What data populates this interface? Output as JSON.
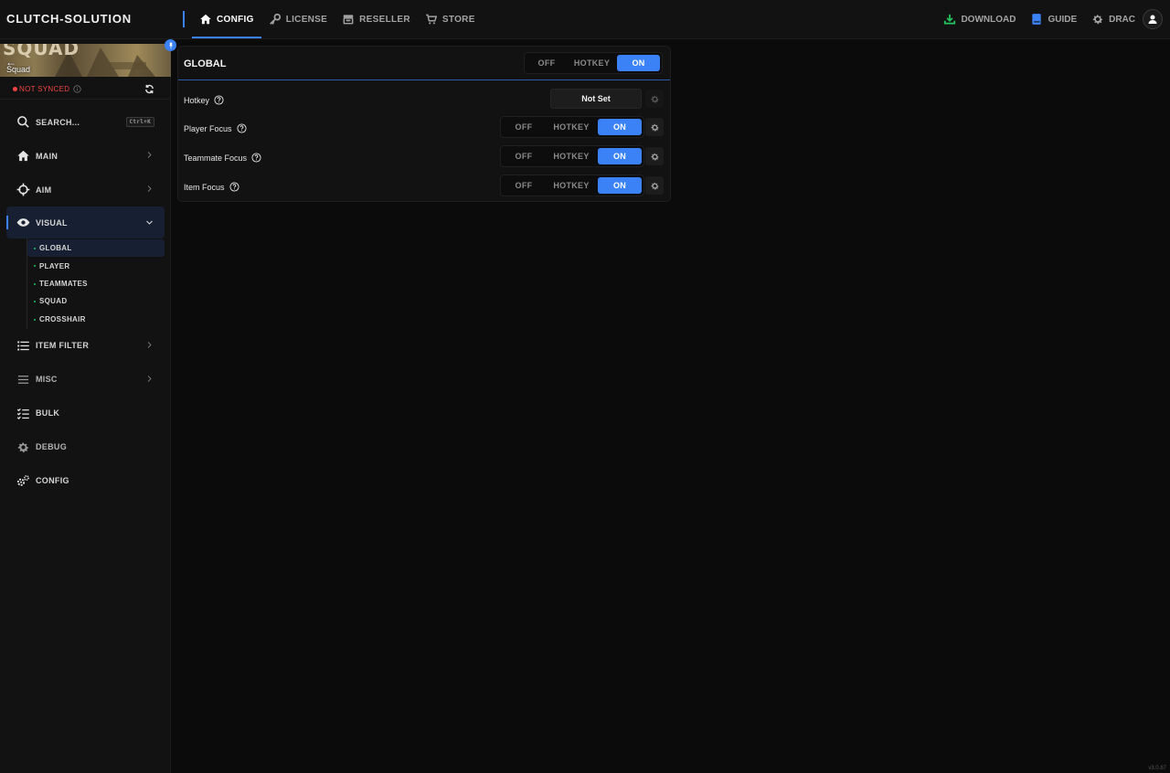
{
  "app": {
    "brand": "CLUTCH-SOLUTION",
    "version": "v3.0.87"
  },
  "nav": {
    "items": [
      {
        "label": "CONFIG",
        "icon": "home-icon",
        "active": true
      },
      {
        "label": "LICENSE",
        "icon": "key-icon",
        "active": false
      },
      {
        "label": "RESELLER",
        "icon": "store-icon",
        "active": false
      },
      {
        "label": "STORE",
        "icon": "cart-icon",
        "active": false
      }
    ],
    "right": {
      "download": "DOWNLOAD",
      "guide": "GUIDE",
      "user": "DRAC"
    }
  },
  "sidebar": {
    "game": {
      "label": "Squad",
      "banner_text": "SQUAD"
    },
    "sync": {
      "status": "NOT SYNCED"
    },
    "search": {
      "label": "SEARCH...",
      "shortcut": "Ctrl+K"
    },
    "items": [
      {
        "label": "MAIN",
        "icon": "home-icon"
      },
      {
        "label": "AIM",
        "icon": "crosshair-icon"
      },
      {
        "label": "VISUAL",
        "icon": "eye-icon",
        "active": true
      },
      {
        "label": "ITEM FILTER",
        "icon": "list-icon"
      },
      {
        "label": "MISC",
        "icon": "menu-icon"
      },
      {
        "label": "BULK",
        "icon": "checklist-icon"
      },
      {
        "label": "DEBUG",
        "icon": "gear-icon"
      },
      {
        "label": "CONFIG",
        "icon": "gears-icon"
      }
    ],
    "visual_sub": [
      "GLOBAL",
      "PLAYER",
      "TEAMMATES",
      "SQUAD",
      "CROSSHAIR"
    ],
    "visual_sub_active": "GLOBAL"
  },
  "panel": {
    "title": "GLOBAL",
    "mode_options": [
      "OFF",
      "HOTKEY",
      "ON"
    ],
    "mode_selected": "ON",
    "rows": [
      {
        "label": "Hotkey",
        "type": "hotkey",
        "value": "Not Set"
      },
      {
        "label": "Player Focus",
        "type": "mode",
        "selected": "ON"
      },
      {
        "label": "Teammate Focus",
        "type": "mode",
        "selected": "ON"
      },
      {
        "label": "Item Focus",
        "type": "mode",
        "selected": "ON"
      }
    ]
  },
  "colors": {
    "accent": "#3b82f6",
    "danger": "#ef4444",
    "sub_dot": "#22c55e",
    "download_icon": "#22c55e"
  }
}
